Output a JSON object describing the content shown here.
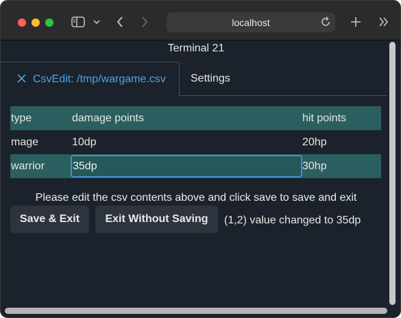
{
  "browser": {
    "url": "localhost",
    "icons": [
      "sidebar-toggle-icon",
      "chevron-down-icon",
      "back-icon",
      "forward-icon",
      "reload-icon",
      "new-tab-icon",
      "overflow-icon"
    ]
  },
  "terminal": {
    "title": "Terminal 21"
  },
  "tabs": {
    "active_label": "CsvEdit: /tmp/wargame.csv",
    "settings_label": "Settings"
  },
  "table": {
    "headers": [
      "type",
      "damage points",
      "hit points"
    ],
    "rows": [
      [
        "mage",
        "10dp",
        "20hp"
      ],
      [
        "warrior",
        "35dp",
        "30hp"
      ]
    ]
  },
  "instructions": "Please edit the csv contents above and click save to save and exit",
  "buttons": {
    "save_exit": "Save & Exit",
    "exit_no_save": "Exit Without Saving"
  },
  "status": "(1,2) value changed to 35dp",
  "colors": {
    "accent": "#4aa3e6",
    "highlight_row": "#2b5f5f",
    "edit_border": "#3f8fd2"
  }
}
